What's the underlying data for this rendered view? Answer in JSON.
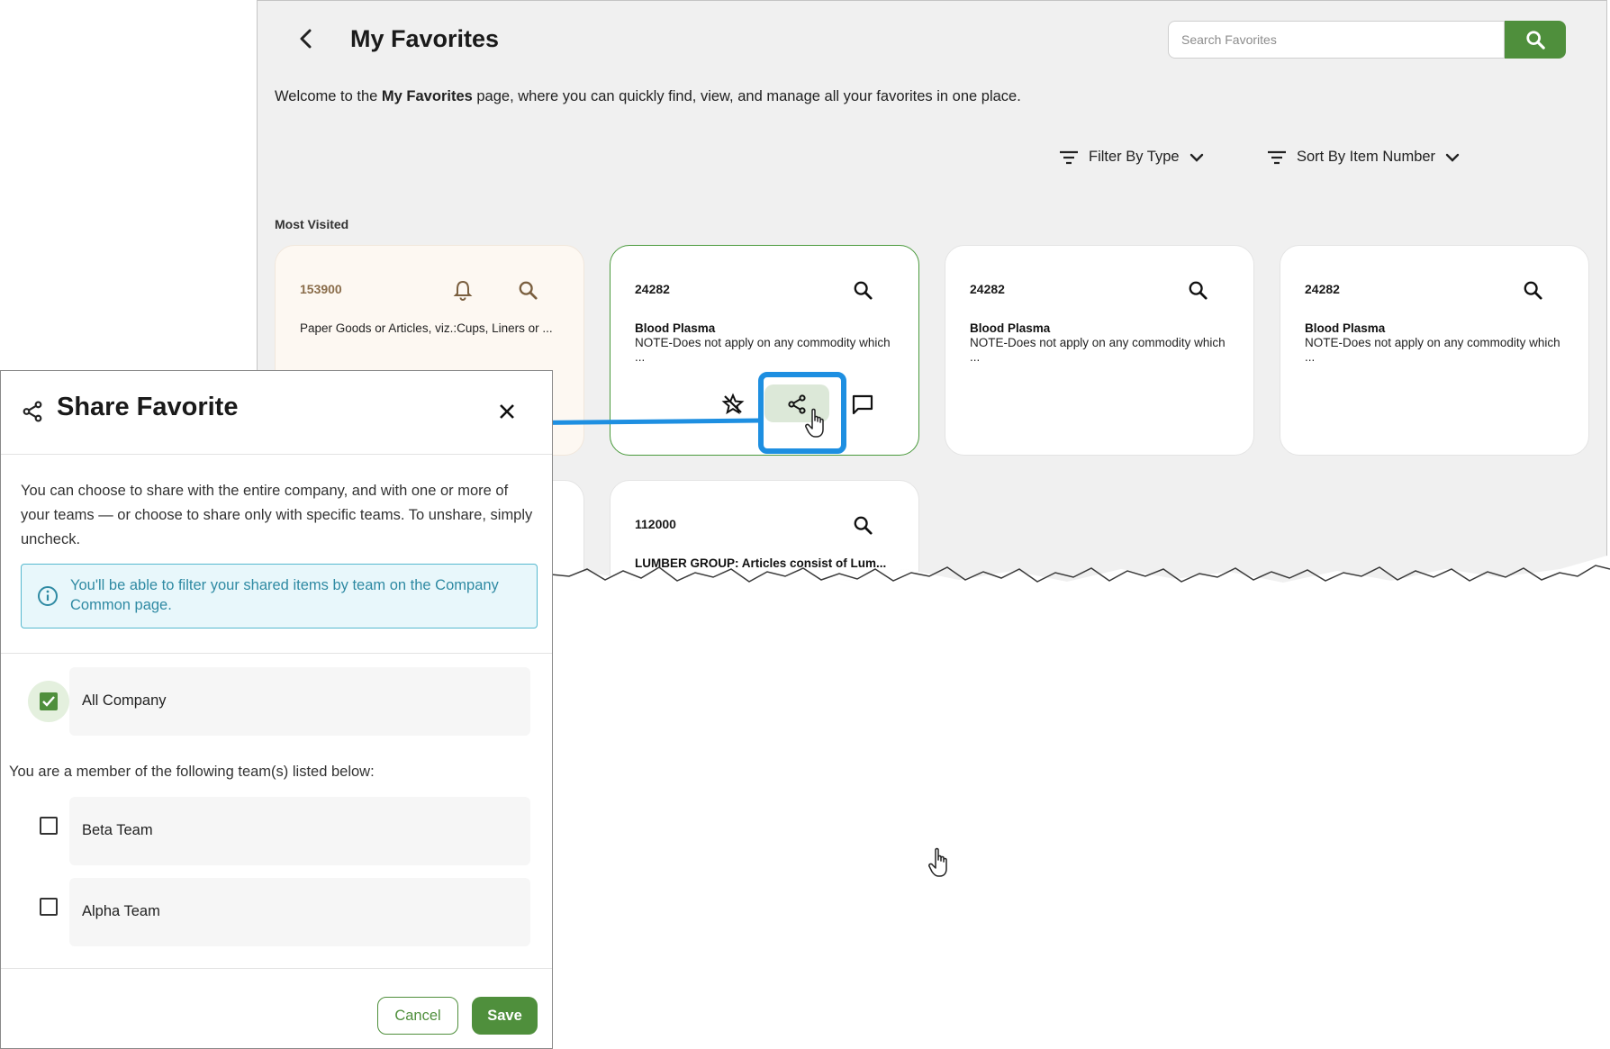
{
  "header": {
    "title": "My Favorites",
    "back_icon": "chevron-left-icon"
  },
  "search": {
    "placeholder": "Search Favorites",
    "button_icon": "search-icon"
  },
  "welcome": {
    "prefix": "Welcome to the ",
    "bold": "My Favorites",
    "suffix": " page, where you can quickly find, view, and manage all your favorites in one place."
  },
  "filters": {
    "filter_label": "Filter By Type",
    "sort_label": "Sort By Item Number"
  },
  "section": {
    "most_visited": "Most Visited"
  },
  "cards": [
    {
      "number": "153900",
      "title": "",
      "description": "Paper Goods or Articles, viz.:Cups, Liners or ..."
    },
    {
      "number": "24282",
      "title": "Blood Plasma",
      "description": "NOTE-Does not apply on any commodity which ..."
    },
    {
      "number": "24282",
      "title": "Blood Plasma",
      "description": "NOTE-Does not apply on any commodity which ..."
    },
    {
      "number": "24282",
      "title": "Blood Plasma",
      "description": "NOTE-Does not apply on any commodity which ..."
    },
    {
      "number": "112000",
      "title": "LUMBER GROUP: Articles consist of Lum...",
      "description": ""
    }
  ],
  "dialog": {
    "title": "Share Favorite",
    "intro": "You can choose to share with the entire company, and with one or more of your teams — or choose to share only with specific teams. To unshare, simply uncheck.",
    "info": "You'll be able to filter your shared items by team on the Company Common page.",
    "all_company": {
      "label": "All Company",
      "checked": true
    },
    "member_text": "You are a member of the following team(s) listed below:",
    "teams": [
      {
        "label": "Beta Team",
        "checked": false
      },
      {
        "label": "Alpha Team",
        "checked": false
      }
    ],
    "cancel_label": "Cancel",
    "save_label": "Save"
  },
  "colors": {
    "brand_green": "#4f8f3c",
    "callout_blue": "#1e8fe1",
    "info_text": "#2f8aa3",
    "info_bg": "#e8f7fb"
  }
}
